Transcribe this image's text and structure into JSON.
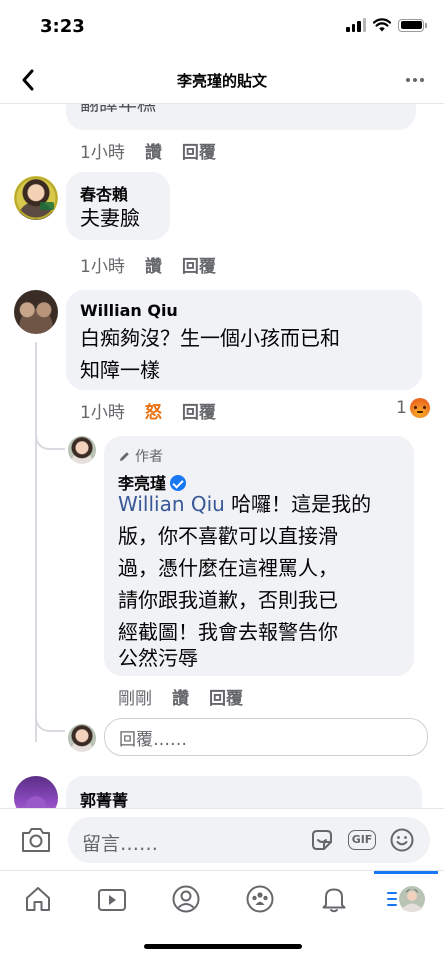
{
  "status_bar": {
    "time": "3:23"
  },
  "header": {
    "title": "李亮瑾的貼文"
  },
  "comments": [
    {
      "text_line": "翻譯年糕",
      "time": "1小時",
      "like_label": "讚",
      "reply_label": "回覆"
    },
    {
      "author": "春杏賴",
      "text": "夫妻臉",
      "time": "1小時",
      "like_label": "讚",
      "reply_label": "回覆"
    },
    {
      "author": "Willian Qiu",
      "text_lines": [
        "白痴夠沒？生一個小孩而已和",
        "知障一樣"
      ],
      "time": "1小時",
      "reaction_label": "怒",
      "reply_label": "回覆",
      "reaction_count": "1"
    },
    {
      "author_badge": "作者",
      "author": "李亮瑾",
      "verified": true,
      "mention": "Willian Qiu",
      "text_lines": [
        " 哈囉！這是我的",
        "版，你不喜歡可以直接滑",
        "過，憑什麼在這裡罵人，",
        "請你跟我道歉，否則我已",
        "經截圖！我會去報警告你",
        "公然污辱"
      ],
      "time": "剛剛",
      "like_label": "讚",
      "reply_label": "回覆"
    },
    {
      "author": "郭菁菁"
    }
  ],
  "reply_input": {
    "placeholder": "回覆……"
  },
  "composer": {
    "placeholder": "留言……",
    "gif_label": "GIF"
  },
  "colors": {
    "facebook_blue": "#1877f2",
    "angry_orange": "#e9710f",
    "bubble_gray": "#f0f2f5"
  },
  "icons": [
    "back-arrow-icon",
    "more-options-icon",
    "camera-icon",
    "sticker-icon",
    "gif-icon",
    "emoji-icon",
    "home-icon",
    "watch-icon",
    "profile-icon",
    "groups-icon",
    "notifications-icon",
    "menu-icon"
  ]
}
